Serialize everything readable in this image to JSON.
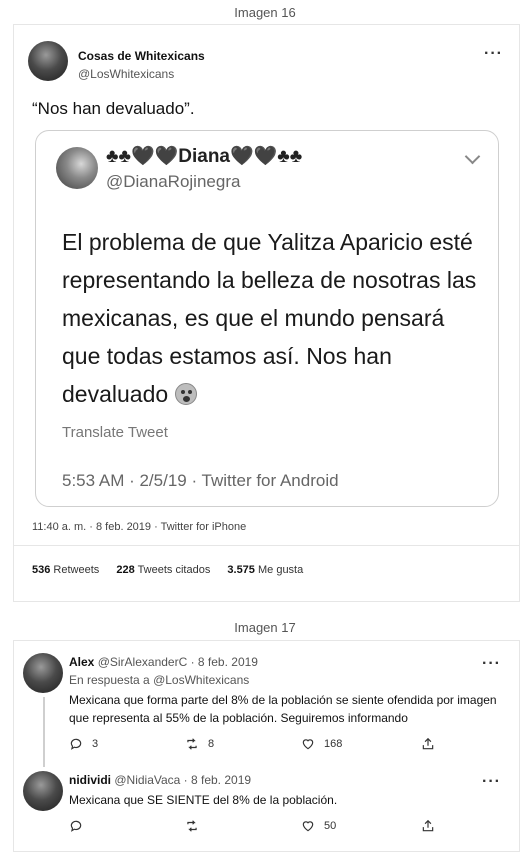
{
  "caption16": "Imagen 16",
  "caption17": "Imagen 17",
  "tweet16": {
    "name": "Cosas de Whitexicans",
    "handle": "@LosWhitexicans",
    "text": "“Nos han devaluado”.",
    "quote": {
      "name": "♣♣🖤🖤Diana🖤🖤♣♣",
      "handle": "@DianaRojinegra",
      "body": "El problema de que Yalitza Aparicio esté representando la belleza de nosotras las mexicanas, es que el mundo pensará que todas estamos así. Nos han devaluado",
      "translate": "Translate Tweet",
      "meta": "5:53 AM · 2/5/19 · Twitter for Android"
    },
    "meta": "11:40 a. m. · 8 feb. 2019 · Twitter for iPhone",
    "retweets_count": "536",
    "retweets_label": "Retweets",
    "quotes_count": "228",
    "quotes_label": "Tweets citados",
    "likes_count": "3.575",
    "likes_label": "Me gusta"
  },
  "reply1": {
    "name": "Alex",
    "handle_date": "@SirAlexanderC · 8 feb. 2019",
    "in_reply_prefix": "En respuesta a",
    "in_reply_handle": "@LosWhitexicans",
    "text": "Mexicana que forma parte del 8% de la población se siente ofendida por imagen que representa al 55% de la población. Seguiremos informando",
    "replies": "3",
    "retweets": "8",
    "likes": "168"
  },
  "reply2": {
    "name": "nidividi",
    "handle_date": "@NidiaVaca · 8 feb. 2019",
    "text": "Mexicana que SE SIENTE del 8% de la población.",
    "replies": "",
    "retweets": "",
    "likes": "50"
  },
  "icons": [
    "more-icon",
    "chevron-down-icon",
    "reply-icon",
    "retweet-icon",
    "like-icon",
    "share-icon",
    "crying-emoji-icon"
  ]
}
